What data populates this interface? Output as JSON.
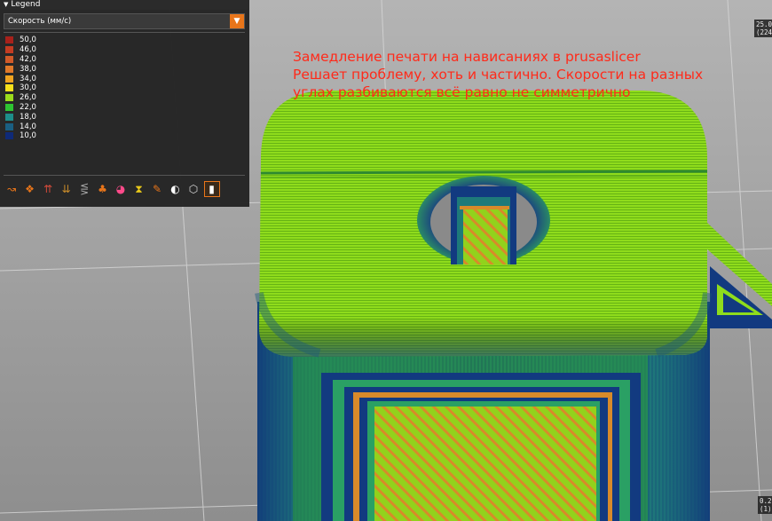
{
  "legend": {
    "title": "Legend",
    "view_type": "Скорость (мм/с)",
    "items": [
      {
        "value": "50,0",
        "color": "#a8211b"
      },
      {
        "value": "46,0",
        "color": "#c43c22"
      },
      {
        "value": "42,0",
        "color": "#d15a29"
      },
      {
        "value": "38,0",
        "color": "#e0792a"
      },
      {
        "value": "34,0",
        "color": "#f0a420"
      },
      {
        "value": "30,0",
        "color": "#f5e01b"
      },
      {
        "value": "26,0",
        "color": "#9bdc1c"
      },
      {
        "value": "22,0",
        "color": "#2ec432"
      },
      {
        "value": "18,0",
        "color": "#1d8e8a"
      },
      {
        "value": "14,0",
        "color": "#1a5f82"
      },
      {
        "value": "10,0",
        "color": "#0f2a78"
      }
    ],
    "toolbar": [
      {
        "icon": "travel-icon",
        "glyph": "↝",
        "color": "#e8751a",
        "active": false
      },
      {
        "icon": "wipe-icon",
        "glyph": "❖",
        "color": "#e8751a",
        "active": false
      },
      {
        "icon": "retractions-icon",
        "glyph": "⇈",
        "color": "#d24a3a",
        "active": false
      },
      {
        "icon": "deretractions-icon",
        "glyph": "⇊",
        "color": "#c78a2a",
        "active": false
      },
      {
        "icon": "seams-icon",
        "glyph": "⋚",
        "color": "#aaaaaa",
        "active": false
      },
      {
        "icon": "tool-changes-icon",
        "glyph": "♣",
        "color": "#e8751a",
        "active": false
      },
      {
        "icon": "color-changes-icon",
        "glyph": "◕",
        "color": "#ff4a8a",
        "active": false
      },
      {
        "icon": "pause-prints-icon",
        "glyph": "⧗",
        "color": "#e8c81a",
        "active": false
      },
      {
        "icon": "custom-gcodes-icon",
        "glyph": "✎",
        "color": "#e8751a",
        "active": false
      },
      {
        "icon": "center-of-gravity-icon",
        "glyph": "◐",
        "color": "#ffffff",
        "active": false
      },
      {
        "icon": "shells-icon",
        "glyph": "⬡",
        "color": "#dddddd",
        "active": false
      },
      {
        "icon": "tool-marker-icon",
        "glyph": "▮",
        "color": "#ffffff",
        "active": true
      }
    ]
  },
  "annotation": {
    "lines": [
      "Замедление печати на нависаниях в prusaslicer",
      "Решает проблему, хоть и частично. Скорости на разных",
      "углах разбиваются всё равно не симметрично"
    ],
    "color": "#ff2a1a"
  },
  "vertical_slider": {
    "top_value": "25.0",
    "top_layer": "(224",
    "bottom_value": "0.2",
    "bottom_layer": "(1)"
  }
}
